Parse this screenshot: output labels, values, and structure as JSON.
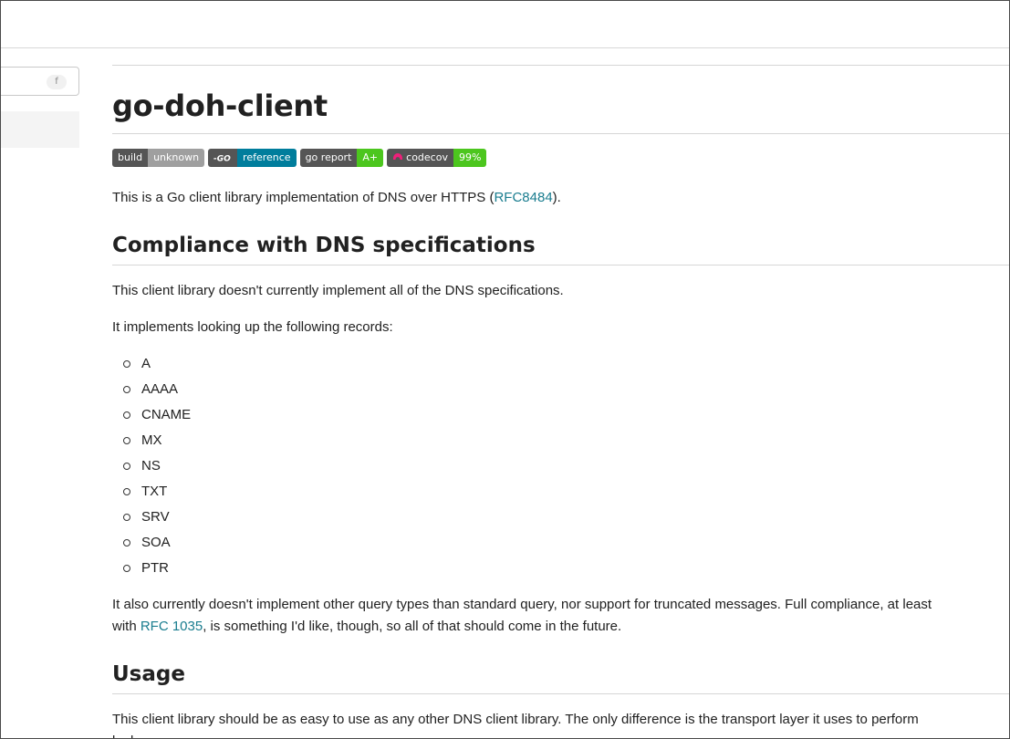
{
  "sidebar": {
    "search_shortcut": "f"
  },
  "page": {
    "title": "go-doh-client"
  },
  "badges": [
    {
      "label": "build",
      "value": "unknown",
      "value_color": "#9f9f9f"
    },
    {
      "label": "",
      "value": "reference",
      "value_color": "#007d9c",
      "icon": "go-icon"
    },
    {
      "label": "go report",
      "value": "A+",
      "value_color": "#4cc61e"
    },
    {
      "label": "codecov",
      "value": "99%",
      "value_color": "#4cc61e",
      "icon": "codecov-icon"
    }
  ],
  "intro": {
    "before": "This is a Go client library implementation of DNS over HTTPS (",
    "link": "RFC8484",
    "after": ")."
  },
  "compliance": {
    "heading": "Compliance with DNS specifications",
    "p1": "This client library doesn't currently implement all of the DNS specifications.",
    "p2": "It implements looking up the following records:",
    "records": [
      "A",
      "AAAA",
      "CNAME",
      "MX",
      "NS",
      "TXT",
      "SRV",
      "SOA",
      "PTR"
    ],
    "p3_line1": "It also currently doesn't implement other query types than standard query, nor support for truncated messages. Full compliance, at least",
    "p3_with": "with ",
    "p3_link": "RFC 1035",
    "p3_after": ", is something I'd like, though, so all of that should come in the future."
  },
  "usage": {
    "heading": "Usage",
    "p1": "This client library should be as easy to use as any other DNS client library. The only difference is the transport layer it uses to perform",
    "p1_cont": "lookups."
  }
}
